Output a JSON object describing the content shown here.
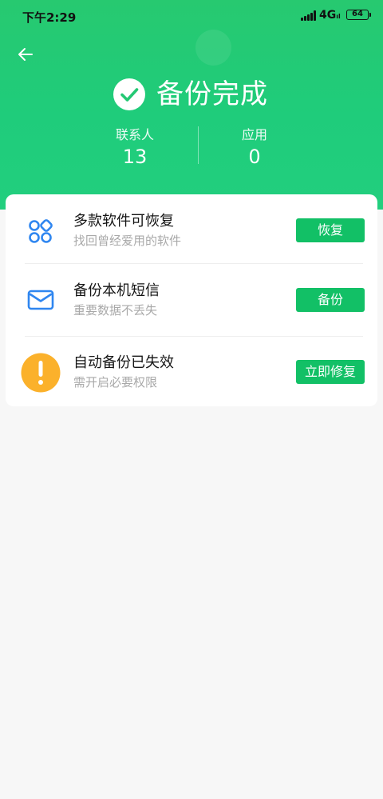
{
  "status_bar": {
    "time": "下午2:29",
    "network": "4G",
    "network_sub": "ıl",
    "battery": "64"
  },
  "header": {
    "title": "备份完成",
    "stats": [
      {
        "label": "联系人",
        "value": "13"
      },
      {
        "label": "应用",
        "value": "0"
      }
    ]
  },
  "items": [
    {
      "title": "多款软件可恢复",
      "subtitle": "找回曾经爱用的软件",
      "button": "恢复",
      "icon": "apps-grid-icon"
    },
    {
      "title": "备份本机短信",
      "subtitle": "重要数据不丢失",
      "button": "备份",
      "icon": "mail-icon"
    },
    {
      "title": "自动备份已失效",
      "subtitle": "需开启必要权限",
      "button": "立即修复",
      "icon": "warning-icon"
    }
  ],
  "colors": {
    "header_green": "#22cc78",
    "button_green": "#12c066",
    "icon_blue": "#2f86f0",
    "warning_yellow": "#fbb12b"
  }
}
